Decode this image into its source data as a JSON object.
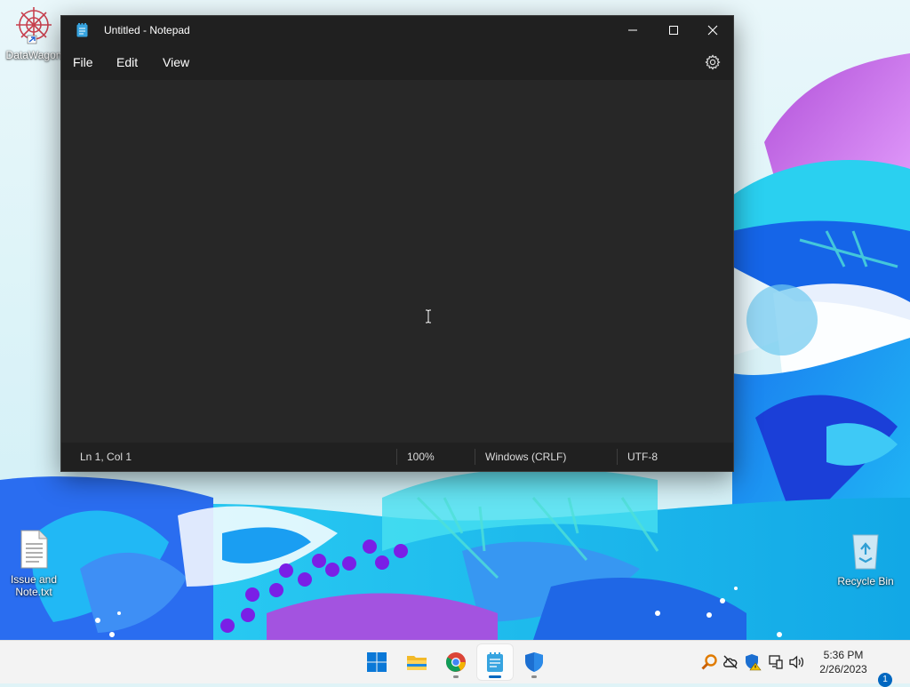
{
  "desktop": {
    "icons": [
      {
        "label": "DataWagon"
      },
      {
        "label": "Issue and Note.txt"
      },
      {
        "label": "Recycle Bin"
      }
    ]
  },
  "notepad": {
    "title": "Untitled - Notepad",
    "menu": [
      "File",
      "Edit",
      "View"
    ],
    "content": "",
    "status": {
      "position": "Ln 1, Col 1",
      "zoom": "100%",
      "line_ending": "Windows (CRLF)",
      "encoding": "UTF-8"
    }
  },
  "taskbar": {
    "apps": [
      "windows-start-icon",
      "file-explorer-icon",
      "chrome-icon",
      "notepad-icon",
      "defender-icon"
    ],
    "tray": [
      "search-magnifier-icon",
      "cloud-offline-icon",
      "security-warning-icon",
      "network-icon",
      "volume-icon"
    ],
    "clock": {
      "time": "5:36 PM",
      "date": "2/26/2023"
    },
    "notification_count": "1"
  },
  "colors": {
    "accent": "#0067c0",
    "window_bg": "#272727",
    "chrome_bg": "#202020"
  }
}
